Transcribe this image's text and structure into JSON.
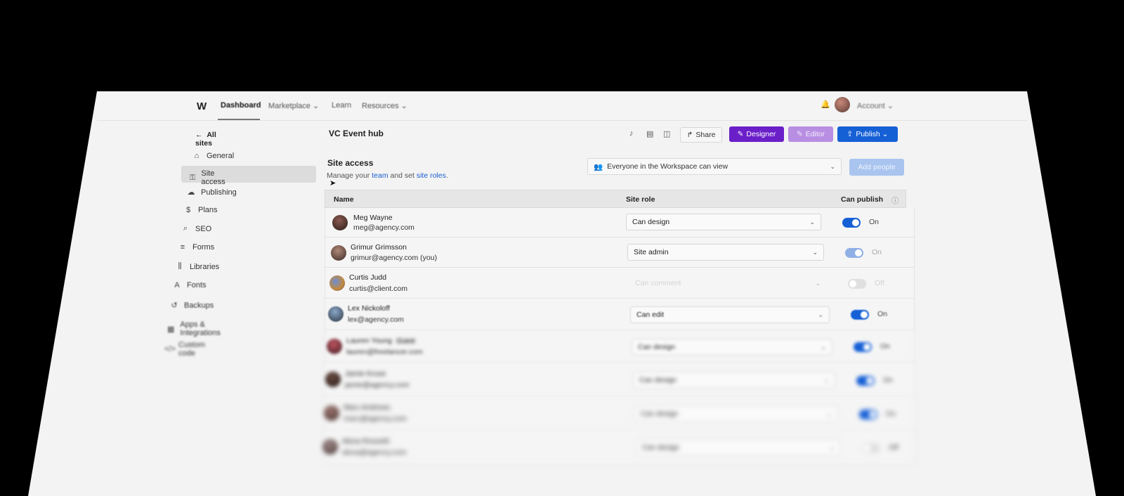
{
  "nav": {
    "logo": "W",
    "items": [
      "Dashboard",
      "Marketplace ⌄",
      "Learn",
      "Resources ⌄"
    ],
    "account": "Account ⌄"
  },
  "sidebar": {
    "back_label": "All sites",
    "items": [
      {
        "label": "General",
        "icon": "home-icon"
      },
      {
        "label": "Site access",
        "icon": "key-icon"
      },
      {
        "label": "Publishing",
        "icon": "cloud-icon"
      },
      {
        "label": "Plans",
        "icon": "dollar-icon"
      },
      {
        "label": "SEO",
        "icon": "search-icon"
      },
      {
        "label": "Forms",
        "icon": "list-icon"
      },
      {
        "label": "Libraries",
        "icon": "library-icon"
      },
      {
        "label": "Fonts",
        "icon": "font-icon"
      },
      {
        "label": "Backups",
        "icon": "history-icon"
      },
      {
        "label": "Apps & Integrations",
        "icon": "apps-icon"
      },
      {
        "label": "Custom code",
        "icon": "code-icon"
      }
    ]
  },
  "header": {
    "site_title": "VC Event hub",
    "share": "Share",
    "designer": "Designer",
    "editor": "Editor",
    "publish": "Publish ⌄"
  },
  "panel": {
    "title": "Site access",
    "sub_prefix": "Manage your ",
    "sub_link1": "team",
    "sub_mid": " and set ",
    "sub_link2": "site roles",
    "sub_suffix": ".",
    "workspace_select": "Everyone in the Workspace can view",
    "add_people": "Add people"
  },
  "table": {
    "columns": [
      "Name",
      "Site role",
      "Can publish"
    ],
    "rows": [
      {
        "name": "Meg Wayne",
        "email": "meg@agency.com",
        "role": "Can design",
        "publish": "On"
      },
      {
        "name": "Grimur Grimsson",
        "email": "grimur@agency.com (you)",
        "role": "Site admin",
        "publish": "On"
      },
      {
        "name": "Curtis Judd",
        "email": "curtis@client.com",
        "role": "Can comment",
        "publish": "Off"
      },
      {
        "name": "Lex Nickoloff",
        "email": "lex@agency.com",
        "role": "Can edit",
        "publish": "On"
      },
      {
        "name": "Lauren Young",
        "badge": "Guest",
        "email": "lauren@freelancer.com",
        "role": "Can design",
        "publish": "On"
      },
      {
        "name": "Jamie Kruse",
        "email": "jamie@agency.com",
        "role": "Can design",
        "publish": "On"
      },
      {
        "name": "Marc Andrews",
        "email": "marc@agency.com",
        "role": "Can design",
        "publish": "On"
      },
      {
        "name": "Alexa Rossetti",
        "email": "alexa@agency.com",
        "role": "Can design",
        "publish": "Off"
      }
    ]
  },
  "colors": {
    "accent_blue": "#1660d6",
    "designer_purple": "#6b1fc9",
    "editor_purple_light": "#b88ee3"
  }
}
